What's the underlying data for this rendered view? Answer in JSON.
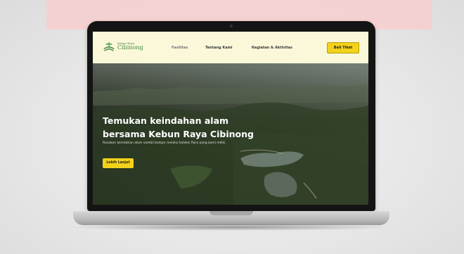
{
  "nav": {
    "logo_small": "Kebun Raya",
    "logo_big": "Cibinong",
    "links": [
      "Fasilitas",
      "Tentang Kami",
      "Kegiatan & Aktivitas"
    ],
    "cta": "Beli Tiket"
  },
  "hero": {
    "title_line1": "Temukan keindahan alam",
    "title_line2": "bersama Kebun Raya Cibinong",
    "subtitle": "Rasakan keindahan alam sambil belajar melalui koleksi flora yang kami miliki.",
    "button": "Lebih Lanjut"
  },
  "colors": {
    "accent": "#f3d21b",
    "nav_bg": "#fbf8da",
    "brand_green": "#3f8a3f"
  }
}
